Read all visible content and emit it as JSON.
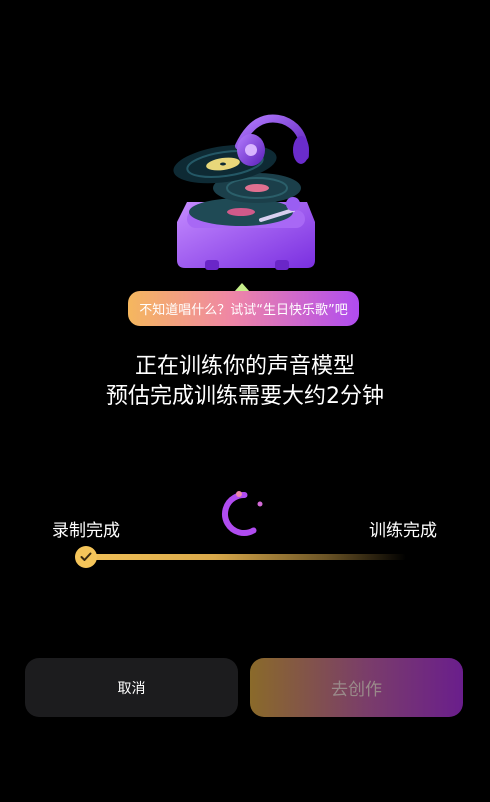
{
  "tip": {
    "text": "不知道唱什么？试试“生日快乐歌”吧"
  },
  "status": {
    "line1": "正在训练你的声音模型",
    "line2": "预估完成训练需要大约2分钟"
  },
  "progress": {
    "left_label": "录制完成",
    "right_label": "训练完成",
    "track_start_color": "#f2c158",
    "check_color": "#f5c55a"
  },
  "buttons": {
    "cancel_label": "取消",
    "create_label": "去创作"
  },
  "icons": {
    "hero": "turntable-headphones-illustration",
    "spinner": "loading-spinner-icon",
    "check": "check-icon"
  },
  "colors": {
    "background": "#000000",
    "accent_purple": "#b04cf0",
    "accent_gold": "#f5c55a"
  }
}
